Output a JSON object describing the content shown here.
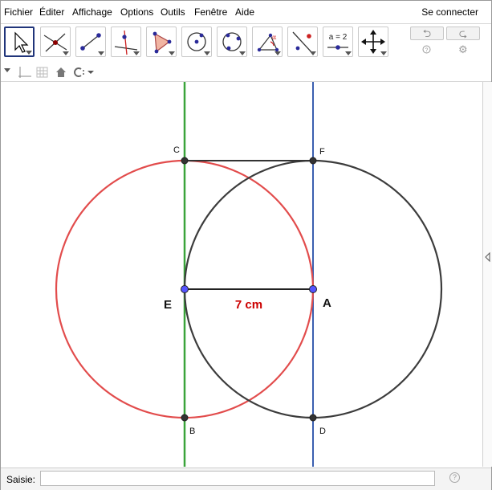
{
  "menu": {
    "items": [
      "Fichier",
      "Éditer",
      "Affichage",
      "Options",
      "Outils",
      "Fenêtre",
      "Aide"
    ],
    "signin": "Se connecter"
  },
  "toolbar": {
    "tools": [
      {
        "name": "move-tool-icon",
        "active": true
      },
      {
        "name": "point-tool-icon",
        "active": false
      },
      {
        "name": "line-tool-icon",
        "active": false
      },
      {
        "name": "perpendicular-line-tool-icon",
        "active": false
      },
      {
        "name": "polygon-tool-icon",
        "active": false
      },
      {
        "name": "circle-center-point-tool-icon",
        "active": false
      },
      {
        "name": "circle-three-points-tool-icon",
        "active": false
      },
      {
        "name": "angle-tool-icon",
        "active": false
      },
      {
        "name": "reflect-tool-icon",
        "active": false
      },
      {
        "name": "slider-tool-icon",
        "active": false,
        "text": "a = 2"
      },
      {
        "name": "move-graphics-tool-icon",
        "active": false
      }
    ],
    "undo_icon": "undo-icon",
    "redo_icon": "redo-icon",
    "help_icon": "help-icon",
    "settings_icon": "gear-icon"
  },
  "stylebar": {
    "icons": [
      "toggle-stylebar-icon",
      "axes-icon",
      "grid-icon",
      "home-view-icon",
      "point-capture-icon"
    ]
  },
  "graphics": {
    "points": [
      {
        "label": "C",
        "x": 0,
        "y": 5
      },
      {
        "label": "F",
        "x": 5,
        "y": 5
      },
      {
        "label": "E",
        "x": 0,
        "y": 0
      },
      {
        "label": "A",
        "x": 5,
        "y": 0
      },
      {
        "label": "B",
        "x": 0,
        "y": -5
      },
      {
        "label": "D",
        "x": 5,
        "y": -5
      }
    ],
    "segment_label": "7 cm",
    "colors": {
      "red_circle": "#e24c4c",
      "dark_circle": "#3c3c3c",
      "green_line": "#3aa43a",
      "blue_line": "#3a5fb0",
      "label_red": "#cc0000",
      "point_fill": "#5555ff"
    }
  },
  "inputbar": {
    "label": "Saisie:",
    "value": "",
    "placeholder": ""
  }
}
